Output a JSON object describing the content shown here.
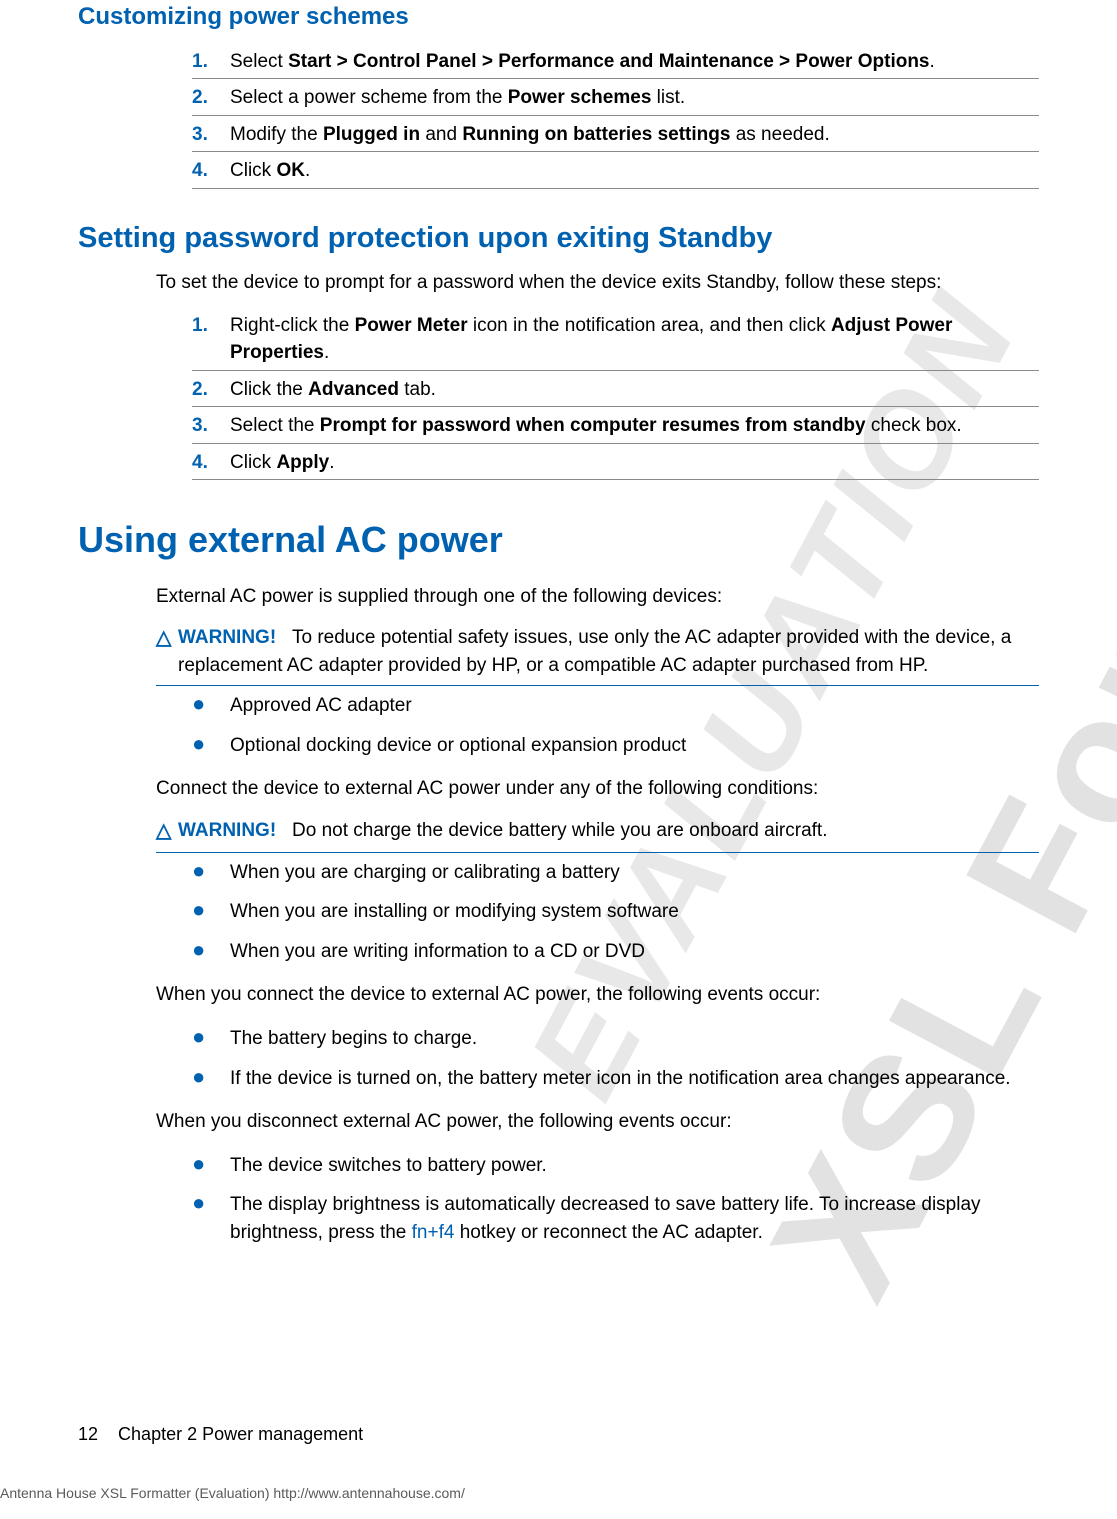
{
  "watermark": {
    "line1": "XSL Formatter",
    "line2": "EVALUATION"
  },
  "sections": {
    "customizing": {
      "title": "Customizing power schemes",
      "steps": [
        {
          "num": "1.",
          "pre": "Select ",
          "bold": "Start > Control Panel > Performance and Maintenance > Power Options",
          "post": "."
        },
        {
          "num": "2.",
          "pre": "Select a power scheme from the ",
          "bold": "Power schemes",
          "post": " list."
        },
        {
          "num": "3.",
          "pre": "Modify the ",
          "bold": "Plugged in",
          "mid": " and ",
          "bold2": "Running on batteries settings",
          "post": " as needed."
        },
        {
          "num": "4.",
          "pre": "Click ",
          "bold": "OK",
          "post": "."
        }
      ]
    },
    "standby": {
      "title": "Setting password protection upon exiting Standby",
      "intro": "To set the device to prompt for a password when the device exits Standby, follow these steps:",
      "steps": [
        {
          "num": "1.",
          "pre": "Right-click the ",
          "bold": "Power Meter",
          "mid": " icon in the notification area, and then click ",
          "bold2": "Adjust Power Properties",
          "post": "."
        },
        {
          "num": "2.",
          "pre": "Click the ",
          "bold": "Advanced",
          "post": " tab."
        },
        {
          "num": "3.",
          "pre": "Select the ",
          "bold": "Prompt for password when computer resumes from standby",
          "post": " check box."
        },
        {
          "num": "4.",
          "pre": "Click ",
          "bold": "Apply",
          "post": "."
        }
      ]
    },
    "ac": {
      "title": "Using external AC power",
      "p1": "External AC power is supplied through one of the following devices:",
      "warn1": {
        "label": "WARNING!",
        "text": "To reduce potential safety issues, use only the AC adapter provided with the device, a replacement AC adapter provided by HP, or a compatible AC adapter purchased from HP."
      },
      "list1": [
        "Approved AC adapter",
        "Optional docking device or optional expansion product"
      ],
      "p2": "Connect the device to external AC power under any of the following conditions:",
      "warn2": {
        "label": "WARNING!",
        "text": "Do not charge the device battery while you are onboard aircraft."
      },
      "list2": [
        "When you are charging or calibrating a battery",
        "When you are installing or modifying system software",
        "When you are writing information to a CD or DVD"
      ],
      "p3": "When you connect the device to external AC power, the following events occur:",
      "list3": [
        "The battery begins to charge.",
        "If the device is turned on, the battery meter icon in the notification area changes appearance."
      ],
      "p4": "When you disconnect external AC power, the following events occur:",
      "list4": [
        "The device switches to battery power.",
        {
          "pre": "The display brightness is automatically decreased to save battery life. To increase display brightness, press the ",
          "link": "fn+f4",
          "post": " hotkey or reconnect the AC adapter."
        }
      ]
    }
  },
  "footer": {
    "page_num": "12",
    "chapter": "Chapter 2   Power management",
    "generator": "Antenna House XSL Formatter (Evaluation)  http://www.antennahouse.com/"
  }
}
